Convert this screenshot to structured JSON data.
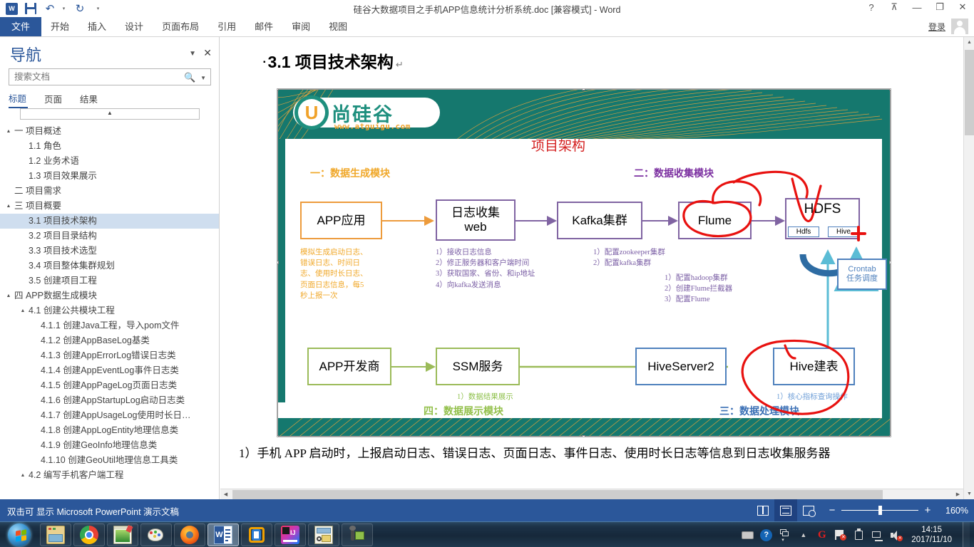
{
  "window": {
    "title": "硅谷大数据项目之手机APP信息统计分析系统.doc [兼容模式] - Word",
    "quick_access": [
      "word-logo",
      "save-icon",
      "undo-icon",
      "redo-icon",
      "customize-qat-icon"
    ],
    "controls": {
      "help": "?",
      "ribbon_display": "⊼",
      "minimize": "—",
      "restore": "❐",
      "close": "✕"
    },
    "signin_label": "登录"
  },
  "ribbon": {
    "tabs": [
      {
        "label": "文件",
        "active": true
      },
      {
        "label": "开始",
        "active": false
      },
      {
        "label": "插入",
        "active": false
      },
      {
        "label": "设计",
        "active": false
      },
      {
        "label": "页面布局",
        "active": false
      },
      {
        "label": "引用",
        "active": false
      },
      {
        "label": "邮件",
        "active": false
      },
      {
        "label": "审阅",
        "active": false
      },
      {
        "label": "视图",
        "active": false
      }
    ]
  },
  "navigation": {
    "title": "导航",
    "search_placeholder": "搜索文档",
    "search_value": "",
    "tabs": [
      {
        "label": "标题",
        "active": true
      },
      {
        "label": "页面",
        "active": false
      },
      {
        "label": "结果",
        "active": false
      }
    ],
    "items": [
      {
        "label": "一 项目概述",
        "level": 1,
        "expander": "▲",
        "selected": false
      },
      {
        "label": "1.1 角色",
        "level": 2,
        "expander": "",
        "selected": false
      },
      {
        "label": "1.2 业务术语",
        "level": 2,
        "expander": "",
        "selected": false
      },
      {
        "label": "1.3 项目效果展示",
        "level": 2,
        "expander": "",
        "selected": false
      },
      {
        "label": "二 项目需求",
        "level": 1,
        "expander": "",
        "selected": false
      },
      {
        "label": "三 项目概要",
        "level": 1,
        "expander": "▲",
        "selected": false
      },
      {
        "label": "3.1 项目技术架构",
        "level": 2,
        "expander": "",
        "selected": true
      },
      {
        "label": "3.2 项目目录结构",
        "level": 2,
        "expander": "",
        "selected": false
      },
      {
        "label": "3.3 项目技术选型",
        "level": 2,
        "expander": "",
        "selected": false
      },
      {
        "label": "3.4 项目整体集群规划",
        "level": 2,
        "expander": "",
        "selected": false
      },
      {
        "label": "3.5 创建项目工程",
        "level": 2,
        "expander": "",
        "selected": false
      },
      {
        "label": "四 APP数据生成模块",
        "level": 1,
        "expander": "▲",
        "selected": false
      },
      {
        "label": "4.1 创建公共模块工程",
        "level": 2,
        "expander": "▲",
        "selected": false
      },
      {
        "label": "4.1.1 创建Java工程，导入pom文件",
        "level": 3,
        "expander": "",
        "selected": false
      },
      {
        "label": "4.1.2 创建AppBaseLog基类",
        "level": 3,
        "expander": "",
        "selected": false
      },
      {
        "label": "4.1.3 创建AppErrorLog错误日志类",
        "level": 3,
        "expander": "",
        "selected": false
      },
      {
        "label": "4.1.4 创建AppEventLog事件日志类",
        "level": 3,
        "expander": "",
        "selected": false
      },
      {
        "label": "4.1.5 创建AppPageLog页面日志类",
        "level": 3,
        "expander": "",
        "selected": false
      },
      {
        "label": "4.1.6 创建AppStartupLog启动日志类",
        "level": 3,
        "expander": "",
        "selected": false
      },
      {
        "label": "4.1.7 创建AppUsageLog使用时长日…",
        "level": 3,
        "expander": "",
        "selected": false
      },
      {
        "label": "4.1.8 创建AppLogEntity地理信息类",
        "level": 3,
        "expander": "",
        "selected": false
      },
      {
        "label": "4.1.9 创建GeoInfo地理信息类",
        "level": 3,
        "expander": "",
        "selected": false
      },
      {
        "label": "4.1.10 创建GeoUtil地理信息工具类",
        "level": 3,
        "expander": "",
        "selected": false
      },
      {
        "label": "4.2 编写手机客户端工程",
        "level": 2,
        "expander": "▲",
        "selected": false
      }
    ]
  },
  "document": {
    "heading": "3.1  项目技术架构",
    "heading_bullet": "▪",
    "pilcrow": "↵",
    "paragraph": "1）手机 APP 启动时，上报启动日志、错误日志、页面日志、事件日志、使用时长日志等信息到日志收集服务器"
  },
  "slide": {
    "logo": {
      "char": "U",
      "cn": "尚硅谷",
      "url": "www.atguigu.com"
    },
    "title": "项目架构",
    "modules": [
      {
        "id": "m1",
        "label": "一：数据生成模块",
        "color": "#f0a82a"
      },
      {
        "id": "m2",
        "label": "二：数据收集模块",
        "color": "#7b2fa0"
      },
      {
        "id": "m3",
        "label": "三：数据处理模块",
        "color": "#3a6fb5"
      },
      {
        "id": "m4",
        "label": "四：数据展示模块",
        "color": "#93c04b"
      }
    ],
    "boxes": [
      {
        "id": "app",
        "label": "APP应用",
        "style": "orange"
      },
      {
        "id": "logweb",
        "label": "日志收集\nweb",
        "style": "purple"
      },
      {
        "id": "kafka",
        "label": "Kafka集群",
        "style": "purple"
      },
      {
        "id": "flume",
        "label": "Flume",
        "style": "purple"
      },
      {
        "id": "hdfs",
        "label": "HDFS",
        "style": "purple"
      },
      {
        "id": "hdfs-sub",
        "label": "Hdfs",
        "style": "blue"
      },
      {
        "id": "hive-sub",
        "label": "Hive",
        "style": "blue"
      },
      {
        "id": "crontab",
        "label": "Crontab\n任务调度",
        "style": "blue"
      },
      {
        "id": "appdev",
        "label": "APP开发商",
        "style": "green"
      },
      {
        "id": "ssm",
        "label": "SSM服务",
        "style": "green"
      },
      {
        "id": "hiveserver2",
        "label": "HiveServer2",
        "style": "blue"
      },
      {
        "id": "hivetable",
        "label": "Hive建表",
        "style": "blue"
      }
    ],
    "notes": [
      {
        "id": "n-app",
        "color": "#f0a82a",
        "text": "模拟生成启动日志、\n错误日志、时间日\n志、使用时长日志、\n页面日志信息，每5\n秒上报一次"
      },
      {
        "id": "n-logweb",
        "color": "#7b5fa5",
        "text": "1）接收日志信息\n2）修正服务器和客户端时间\n3）获取国家、省份、和ip地址\n4）向kafka发送消息"
      },
      {
        "id": "n-kafka",
        "color": "#7b5fa5",
        "text": "1）配置zookeeper集群\n2）配置kafka集群"
      },
      {
        "id": "n-flume",
        "color": "#7b5fa5",
        "text": "1）配置hadoop集群\n2）创建Flume拦截器\n3）配置Flume"
      },
      {
        "id": "n-ssm",
        "color": "#8ec04b",
        "text": "1）数据结果展示"
      },
      {
        "id": "n-hive",
        "color": "#6f9fd8",
        "text": "1）核心指标查询操作"
      }
    ],
    "annotations": {
      "ink_color": "#e8110f",
      "plus_mark": "+"
    }
  },
  "statusbar": {
    "message": "双击可 显示 Microsoft PowerPoint 演示文稿",
    "views": [
      {
        "name": "read-mode",
        "icon": "read-view-icon",
        "active": false
      },
      {
        "name": "print-layout",
        "icon": "print-layout-icon",
        "active": true
      },
      {
        "name": "web-layout",
        "icon": "web-layout-icon",
        "active": false
      }
    ],
    "zoom_out": "−",
    "zoom_in": "+",
    "zoom_percent": "160%"
  },
  "taskbar": {
    "start": "start-orb",
    "items": [
      {
        "name": "file-explorer",
        "active": false
      },
      {
        "name": "google-chrome",
        "active": false
      },
      {
        "name": "notepadpp",
        "active": false
      },
      {
        "name": "paint",
        "active": false
      },
      {
        "name": "firefox",
        "active": false
      },
      {
        "name": "microsoft-word",
        "active": true
      },
      {
        "name": "microsoft-office",
        "active": false
      },
      {
        "name": "intellij-idea",
        "active": false
      },
      {
        "name": "screenshot-tool",
        "active": false
      },
      {
        "name": "utility-app",
        "active": false
      }
    ],
    "tray": [
      "keyboard-icon",
      "help-icon",
      "window-switch-icon",
      "show-hidden-icon",
      "360-icon",
      "flag-alert-icon",
      "usb-eject-icon",
      "network-icon",
      "volume-muted-icon"
    ],
    "clock_time": "14:15",
    "clock_date": "2017/11/10"
  }
}
